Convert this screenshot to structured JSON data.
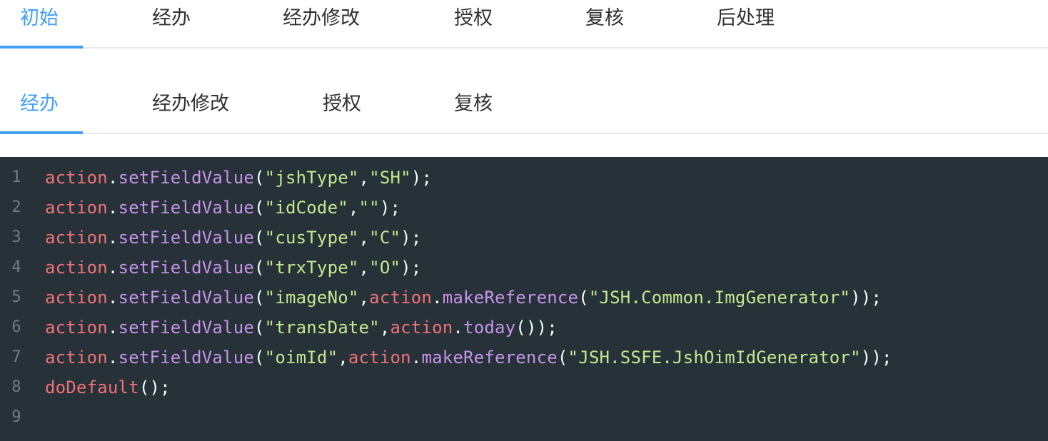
{
  "tabs_top": {
    "items": [
      {
        "label": "初始",
        "active": true
      },
      {
        "label": "经办",
        "active": false
      },
      {
        "label": "经办修改",
        "active": false
      },
      {
        "label": "授权",
        "active": false
      },
      {
        "label": "复核",
        "active": false
      },
      {
        "label": "后处理",
        "active": false
      }
    ]
  },
  "tabs_sub": {
    "items": [
      {
        "label": "经办",
        "active": true
      },
      {
        "label": "经办修改",
        "active": false
      },
      {
        "label": "授权",
        "active": false
      },
      {
        "label": "复核",
        "active": false
      }
    ]
  },
  "editor": {
    "colors": {
      "background": "#263238",
      "object": "#f07178",
      "function": "#c792ea",
      "string": "#c3e88d",
      "punctuation": "#eeffff",
      "line_number": "#717c84"
    },
    "lines": [
      {
        "num": "1",
        "text": "action.setFieldValue(\"jshType\",\"SH\");"
      },
      {
        "num": "2",
        "text": "action.setFieldValue(\"idCode\",\"\");"
      },
      {
        "num": "3",
        "text": "action.setFieldValue(\"cusType\",\"C\");"
      },
      {
        "num": "4",
        "text": "action.setFieldValue(\"trxType\",\"O\");"
      },
      {
        "num": "5",
        "text": "action.setFieldValue(\"imageNo\",action.makeReference(\"JSH.Common.ImgGenerator\"));"
      },
      {
        "num": "6",
        "text": "action.setFieldValue(\"transDate\",action.today());"
      },
      {
        "num": "7",
        "text": "action.setFieldValue(\"oimId\",action.makeReference(\"JSH.SSFE.JshOimIdGenerator\"));"
      },
      {
        "num": "8",
        "text": "doDefault();"
      },
      {
        "num": "9",
        "text": ""
      }
    ]
  }
}
